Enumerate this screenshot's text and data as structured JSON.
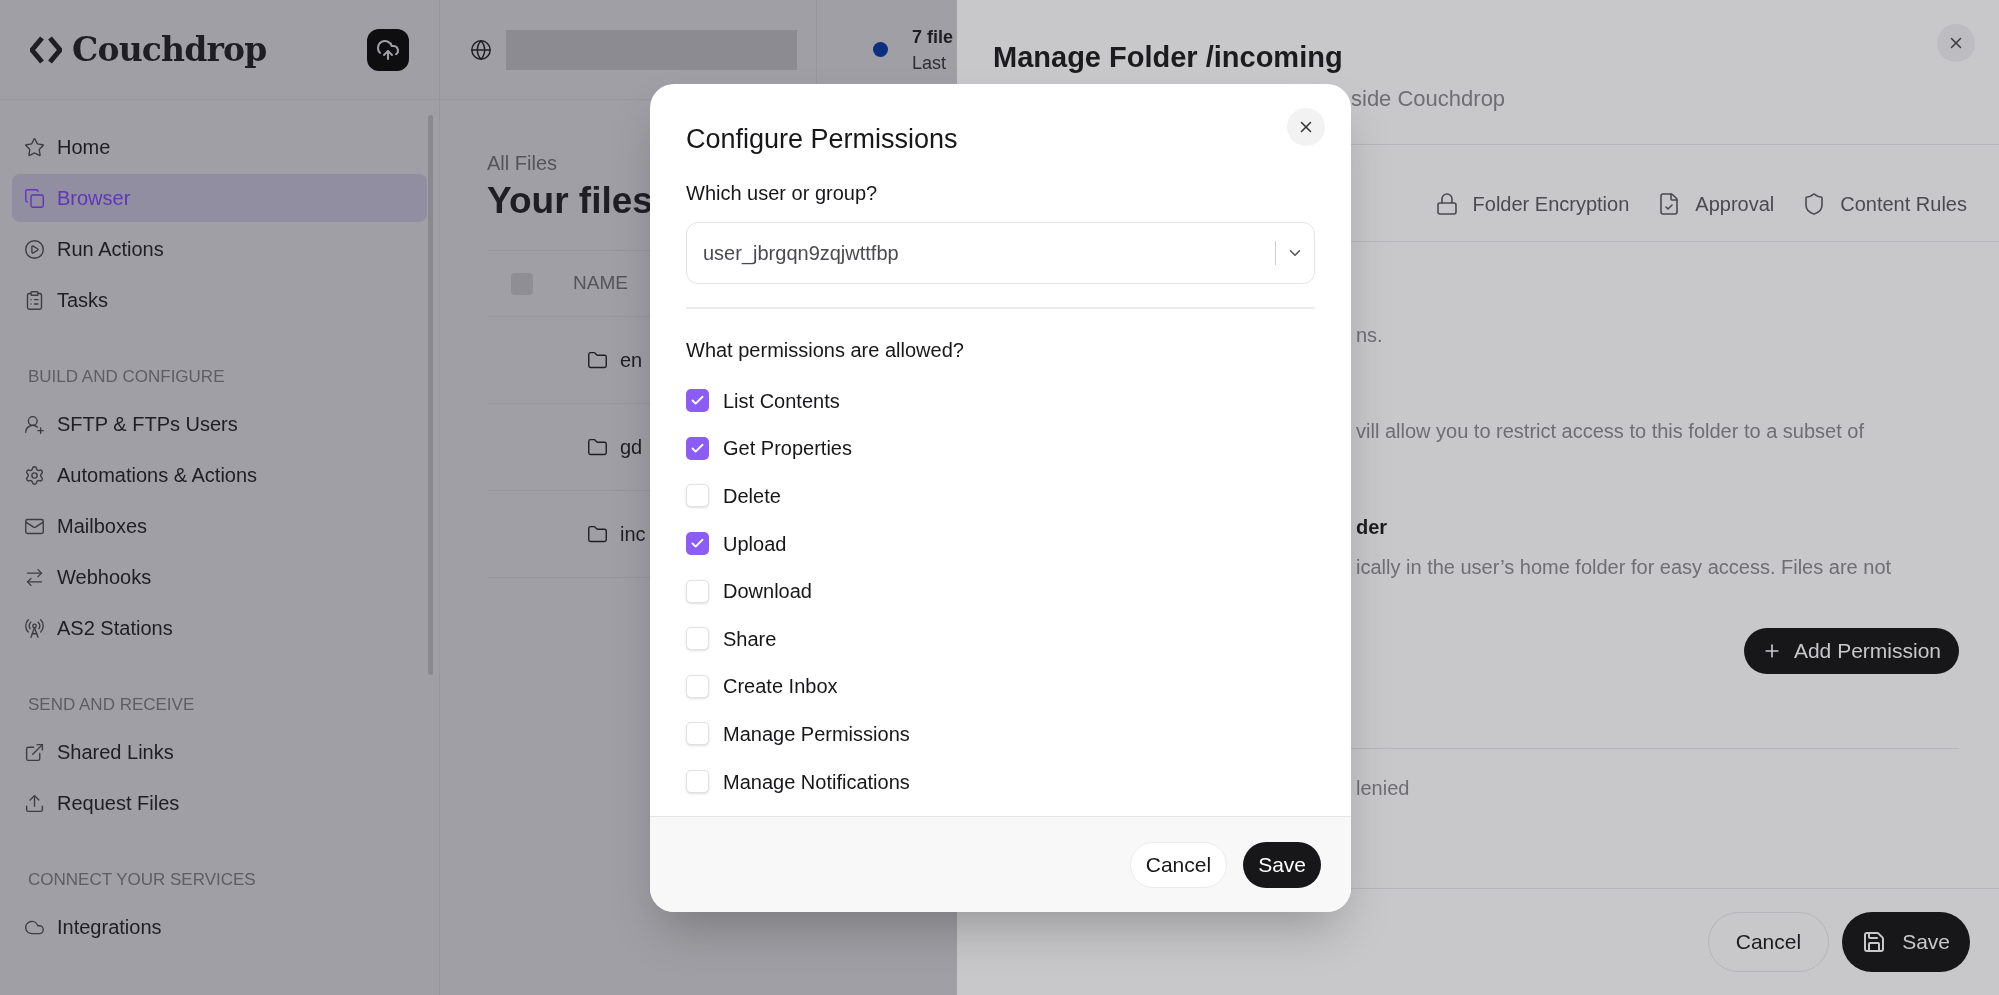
{
  "sidebar": {
    "logo": "Couchdrop",
    "groups": [
      {
        "items": [
          {
            "label": "Home",
            "selected": false
          },
          {
            "label": "Browser",
            "selected": true
          },
          {
            "label": "Run Actions",
            "selected": false
          },
          {
            "label": "Tasks",
            "selected": false
          }
        ]
      },
      {
        "heading": "BUILD AND CONFIGURE",
        "items": [
          {
            "label": "SFTP & FTPs Users",
            "selected": false
          },
          {
            "label": "Automations & Actions",
            "selected": false
          },
          {
            "label": "Mailboxes",
            "selected": false
          },
          {
            "label": "Webhooks",
            "selected": false
          },
          {
            "label": "AS2 Stations",
            "selected": false
          }
        ]
      },
      {
        "heading": "SEND AND RECEIVE",
        "items": [
          {
            "label": "Shared Links",
            "selected": false
          },
          {
            "label": "Request Files",
            "selected": false
          }
        ]
      },
      {
        "heading": "CONNECT YOUR SERVICES",
        "items": [
          {
            "label": "Integrations",
            "selected": false
          }
        ]
      }
    ]
  },
  "header": {
    "files_count": "7 file",
    "last_line": "Last"
  },
  "main": {
    "breadcrumb": "All Files",
    "title": "Your files",
    "column": "NAME",
    "select_all_checked": false,
    "rows": [
      "en",
      "gd",
      "inc"
    ]
  },
  "drawer": {
    "title": "Manage Folder /incoming",
    "subtitle": "side Couchdrop",
    "tabs": [
      {
        "label": "Folder Encryption",
        "selected": false
      },
      {
        "label": "Approval",
        "selected": false
      },
      {
        "label": "Content Rules",
        "selected": false
      }
    ],
    "text_1": "ns.",
    "text_2": "vill allow you to restrict access to this folder to a subset of",
    "heading": "der",
    "text_3": "ically in the user’s home folder for easy access. Files are not",
    "add_button": "Add Permission",
    "denied": "lenied",
    "cancel": "Cancel",
    "save": "Save"
  },
  "modal": {
    "title": "Configure Permissions",
    "user_label": "Which user or group?",
    "user_value": "user_jbrgqn9zqjwttfbp",
    "perm_label": "What permissions are allowed?",
    "permissions": [
      {
        "label": "List Contents",
        "checked": true
      },
      {
        "label": "Get Properties",
        "checked": true
      },
      {
        "label": "Delete",
        "checked": false
      },
      {
        "label": "Upload",
        "checked": true
      },
      {
        "label": "Download",
        "checked": false
      },
      {
        "label": "Share",
        "checked": false
      },
      {
        "label": "Create Inbox",
        "checked": false
      },
      {
        "label": "Manage Permissions",
        "checked": false
      },
      {
        "label": "Manage Notifications",
        "checked": false
      }
    ],
    "cancel": "Cancel",
    "save": "Save"
  }
}
